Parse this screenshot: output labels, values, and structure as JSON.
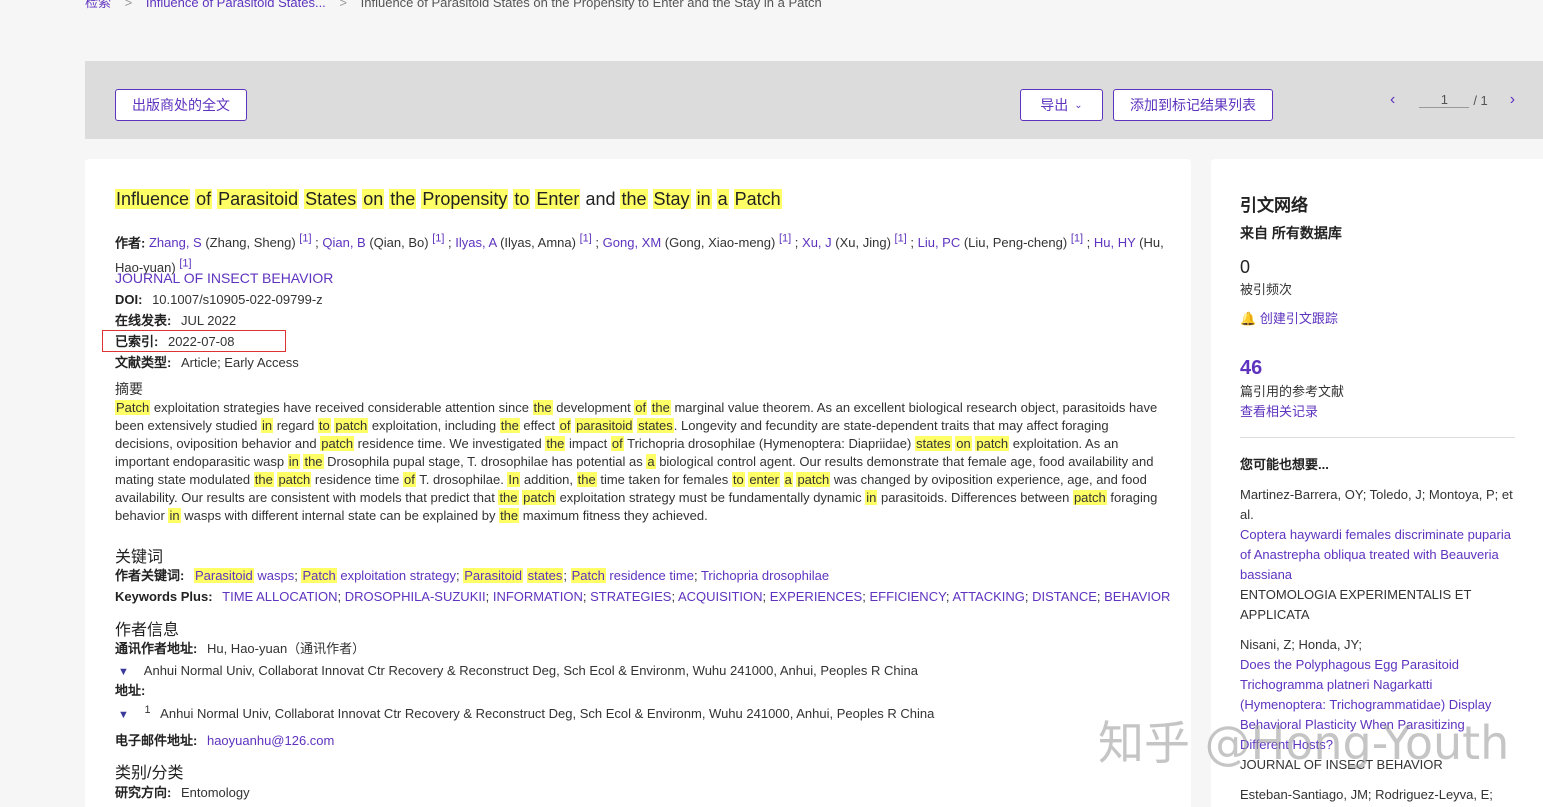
{
  "breadcrumb": {
    "home": "检索",
    "sep": ">",
    "query": "Influence of Parasitoid States...",
    "current": "Influence of Parasitoid States on the Propensity to Enter and the Stay in a Patch"
  },
  "toolbar": {
    "fulltext_label": "出版商处的全文",
    "export_label": "导出",
    "add_marked_label": "添加到标记结果列表",
    "page_current": "1",
    "page_total": "/ 1"
  },
  "record": {
    "title_parts": [
      {
        "t": "Influence",
        "h": true
      },
      {
        "t": " ",
        "h": false
      },
      {
        "t": "of",
        "h": true
      },
      {
        "t": " ",
        "h": false
      },
      {
        "t": "Parasitoid",
        "h": true
      },
      {
        "t": " ",
        "h": false
      },
      {
        "t": "States",
        "h": true
      },
      {
        "t": " ",
        "h": false
      },
      {
        "t": "on",
        "h": true
      },
      {
        "t": " ",
        "h": false
      },
      {
        "t": "the",
        "h": true
      },
      {
        "t": " ",
        "h": false
      },
      {
        "t": "Propensity",
        "h": true
      },
      {
        "t": " ",
        "h": false
      },
      {
        "t": "to",
        "h": true
      },
      {
        "t": " ",
        "h": false
      },
      {
        "t": "Enter",
        "h": true
      },
      {
        "t": " and ",
        "h": false
      },
      {
        "t": "the",
        "h": true
      },
      {
        "t": " ",
        "h": false
      },
      {
        "t": "Stay",
        "h": true
      },
      {
        "t": " ",
        "h": false
      },
      {
        "t": "in",
        "h": true
      },
      {
        "t": " ",
        "h": false
      },
      {
        "t": "a",
        "h": true
      },
      {
        "t": " ",
        "h": false
      },
      {
        "t": "Patch",
        "h": true
      }
    ],
    "authors_label": "作者:",
    "authors": [
      {
        "short": "Zhang, S",
        "full": "(Zhang, Sheng)",
        "ref": "[1]"
      },
      {
        "short": "Qian, B",
        "full": "(Qian, Bo)",
        "ref": "[1]"
      },
      {
        "short": "Ilyas, A",
        "full": "(Ilyas, Amna)",
        "ref": "[1]"
      },
      {
        "short": "Gong, XM",
        "full": "(Gong, Xiao-meng)",
        "ref": "[1]"
      },
      {
        "short": "Xu, J",
        "full": "(Xu, Jing)",
        "ref": "[1]"
      },
      {
        "short": "Liu, PC",
        "full": "(Liu, Peng-cheng)",
        "ref": "[1]"
      },
      {
        "short": "Hu, HY",
        "full": "(Hu, Hao-yuan)",
        "ref": "[1]"
      }
    ],
    "journal": "JOURNAL OF INSECT BEHAVIOR",
    "doi_label": "DOI:",
    "doi": "10.1007/s10905-022-09799-z",
    "online_label": "在线发表:",
    "online": "JUL 2022",
    "indexed_label": "已索引:",
    "indexed": "2022-07-08",
    "doctype_label": "文献类型:",
    "doctype": "Article; Early Access",
    "abstract_label": "摘要",
    "abstract_parts": [
      {
        "t": "Patch",
        "h": true
      },
      {
        "t": " exploitation strategies have received considerable attention since ",
        "h": false
      },
      {
        "t": "the",
        "h": true
      },
      {
        "t": " development ",
        "h": false
      },
      {
        "t": "of",
        "h": true
      },
      {
        "t": " ",
        "h": false
      },
      {
        "t": "the",
        "h": true
      },
      {
        "t": " marginal value theorem. As an excellent biological research object, parasitoids have been extensively studied ",
        "h": false
      },
      {
        "t": "in",
        "h": true
      },
      {
        "t": " regard ",
        "h": false
      },
      {
        "t": "to",
        "h": true
      },
      {
        "t": " ",
        "h": false
      },
      {
        "t": "patch",
        "h": true
      },
      {
        "t": " exploitation, including ",
        "h": false
      },
      {
        "t": "the",
        "h": true
      },
      {
        "t": " effect ",
        "h": false
      },
      {
        "t": "of",
        "h": true
      },
      {
        "t": " ",
        "h": false
      },
      {
        "t": "parasitoid",
        "h": true
      },
      {
        "t": " ",
        "h": false
      },
      {
        "t": "states",
        "h": true
      },
      {
        "t": ". Longevity and fecundity are state-dependent traits that may affect foraging decisions, oviposition behavior and ",
        "h": false
      },
      {
        "t": "patch",
        "h": true
      },
      {
        "t": " residence time. We investigated ",
        "h": false
      },
      {
        "t": "the",
        "h": true
      },
      {
        "t": " impact ",
        "h": false
      },
      {
        "t": "of",
        "h": true
      },
      {
        "t": " Trichopria drosophilae (Hymenoptera: Diapriidae) ",
        "h": false
      },
      {
        "t": "states",
        "h": true
      },
      {
        "t": " ",
        "h": false
      },
      {
        "t": "on",
        "h": true
      },
      {
        "t": " ",
        "h": false
      },
      {
        "t": "patch",
        "h": true
      },
      {
        "t": " exploitation. As an important endoparasitic wasp ",
        "h": false
      },
      {
        "t": "in",
        "h": true
      },
      {
        "t": " ",
        "h": false
      },
      {
        "t": "the",
        "h": true
      },
      {
        "t": " Drosophila pupal stage, T. drosophilae has potential as ",
        "h": false
      },
      {
        "t": "a",
        "h": true
      },
      {
        "t": " biological control agent. Our results demonstrate that female age, food availability and mating state modulated ",
        "h": false
      },
      {
        "t": "the",
        "h": true
      },
      {
        "t": " ",
        "h": false
      },
      {
        "t": "patch",
        "h": true
      },
      {
        "t": " residence time ",
        "h": false
      },
      {
        "t": "of",
        "h": true
      },
      {
        "t": " T. drosophilae. ",
        "h": false
      },
      {
        "t": "In",
        "h": true
      },
      {
        "t": " addition, ",
        "h": false
      },
      {
        "t": "the",
        "h": true
      },
      {
        "t": " time taken for females ",
        "h": false
      },
      {
        "t": "to",
        "h": true
      },
      {
        "t": " ",
        "h": false
      },
      {
        "t": "enter",
        "h": true
      },
      {
        "t": " ",
        "h": false
      },
      {
        "t": "a",
        "h": true
      },
      {
        "t": " ",
        "h": false
      },
      {
        "t": "patch",
        "h": true
      },
      {
        "t": " was changed by oviposition experience, age, and food availability. Our results are consistent with models that predict that ",
        "h": false
      },
      {
        "t": "the",
        "h": true
      },
      {
        "t": " ",
        "h": false
      },
      {
        "t": "patch",
        "h": true
      },
      {
        "t": " exploitation strategy must be fundamentally dynamic ",
        "h": false
      },
      {
        "t": "in",
        "h": true
      },
      {
        "t": " parasitoids. Differences between ",
        "h": false
      },
      {
        "t": "patch",
        "h": true
      },
      {
        "t": " foraging behavior ",
        "h": false
      },
      {
        "t": "in",
        "h": true
      },
      {
        "t": " wasps with different internal state can be explained by ",
        "h": false
      },
      {
        "t": "the",
        "h": true
      },
      {
        "t": " maximum fitness they achieved.",
        "h": false
      }
    ],
    "keywords_heading": "关键词",
    "author_kw_label": "作者关键词:",
    "author_keywords": [
      [
        {
          "t": "Parasitoid",
          "h": true
        },
        {
          "t": " wasps",
          "h": false
        }
      ],
      [
        {
          "t": "Patch",
          "h": true
        },
        {
          "t": " exploitation strategy",
          "h": false
        }
      ],
      [
        {
          "t": "Parasitoid",
          "h": true
        },
        {
          "t": " ",
          "h": false
        },
        {
          "t": "states",
          "h": true
        }
      ],
      [
        {
          "t": "Patch",
          "h": true
        },
        {
          "t": " residence time",
          "h": false
        }
      ],
      [
        {
          "t": "Trichopria drosophilae",
          "h": false
        }
      ]
    ],
    "kw_plus_label": "Keywords Plus:",
    "keywords_plus": [
      "TIME ALLOCATION",
      "DROSOPHILA-SUZUKII",
      "INFORMATION",
      "STRATEGIES",
      "ACQUISITION",
      "EXPERIENCES",
      "EFFICIENCY",
      "ATTACKING",
      "DISTANCE",
      "BEHAVIOR"
    ],
    "author_info_heading": "作者信息",
    "corr_label": "通讯作者地址:",
    "corr_name": "Hu, Hao-yuan（通讯作者）",
    "corr_addr": "Anhui Normal Univ, Collaborat Innovat Ctr Recovery & Reconstruct Deg, Sch Ecol & Environm, Wuhu 241000, Anhui, Peoples R China",
    "addr_label": "地址:",
    "addr_num": "1",
    "addr": "Anhui Normal Univ, Collaborat Innovat Ctr Recovery & Reconstruct Deg, Sch Ecol & Environm, Wuhu 241000, Anhui, Peoples R China",
    "email_label": "电子邮件地址:",
    "email": "haoyuanhu@126.com",
    "category_heading": "类别/分类",
    "research_label": "研究方向:",
    "research": "Entomology"
  },
  "sidebar": {
    "title": "引文网络",
    "from_db": "来自 所有数据库",
    "times_cited": "0",
    "times_cited_label": "被引频次",
    "create_alert": "创建引文跟踪",
    "refs_count": "46",
    "refs_label": "篇引用的参考文献",
    "view_related": "查看相关记录",
    "also_like": "您可能也想要...",
    "suggestions": [
      {
        "authors": "Martinez-Barrera, OY; Toledo, J; Montoya, P; et al.",
        "title": "Coptera haywardi females discriminate puparia of Anastrepha obliqua treated with Beauveria bassiana",
        "journal": "ENTOMOLOGIA EXPERIMENTALIS ET APPLICATA"
      },
      {
        "authors": "Nisani, Z; Honda, JY;",
        "title": "Does the Polyphagous Egg Parasitoid Trichogramma platneri Nagarkatti (Hymenoptera: Trichogrammatidae) Display Behavioral Plasticity When Parasitizing Different Hosts?",
        "journal": "JOURNAL OF INSECT BEHAVIOR"
      },
      {
        "authors": "Esteban-Santiago, JM; Rodriguez-Leyva, E;"
      }
    ]
  },
  "watermark": "知乎 @Hong-Youth"
}
